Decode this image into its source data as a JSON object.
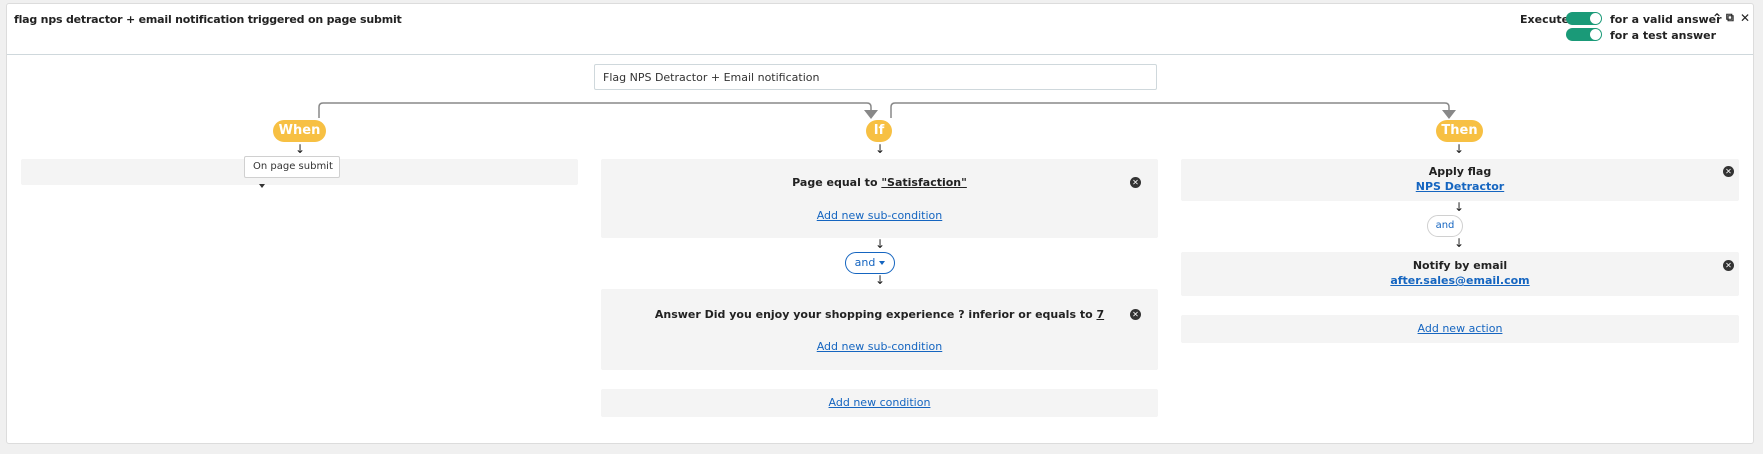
{
  "header": {
    "rule_title": "flag nps detractor + email notification triggered on page submit",
    "execute_label": "Execute",
    "valid_label": "for a valid answer",
    "test_label": "for a test answer",
    "collapse_icon": "chevron-up-icon",
    "copy_icon": "copy-icon",
    "close_icon": "close-icon",
    "toggle_color": "#1a9a78"
  },
  "rule_name": {
    "value": "Flag NPS Detractor + Email notification"
  },
  "sections": {
    "when": "When",
    "if": "If",
    "then": "Then",
    "pill_color": "#f7c043"
  },
  "when": {
    "trigger_value": "On page submit"
  },
  "conditions": [
    {
      "prefix": "Page equal to ",
      "value": "\"Satisfaction\"",
      "sub_link": "Add new sub-condition"
    },
    {
      "prefix": "Answer Did you enjoy your shopping experience ? inferior or equals to ",
      "value": "7",
      "sub_link": "Add new sub-condition"
    }
  ],
  "operator": "and",
  "add_condition": "Add new condition",
  "actions": [
    {
      "title": "Apply flag",
      "value": "NPS Detractor"
    },
    {
      "title": "Notify by email",
      "value": "after.sales@email.com"
    }
  ],
  "actions_operator": "and",
  "add_action": "Add new action",
  "link_color": "#1565c0"
}
